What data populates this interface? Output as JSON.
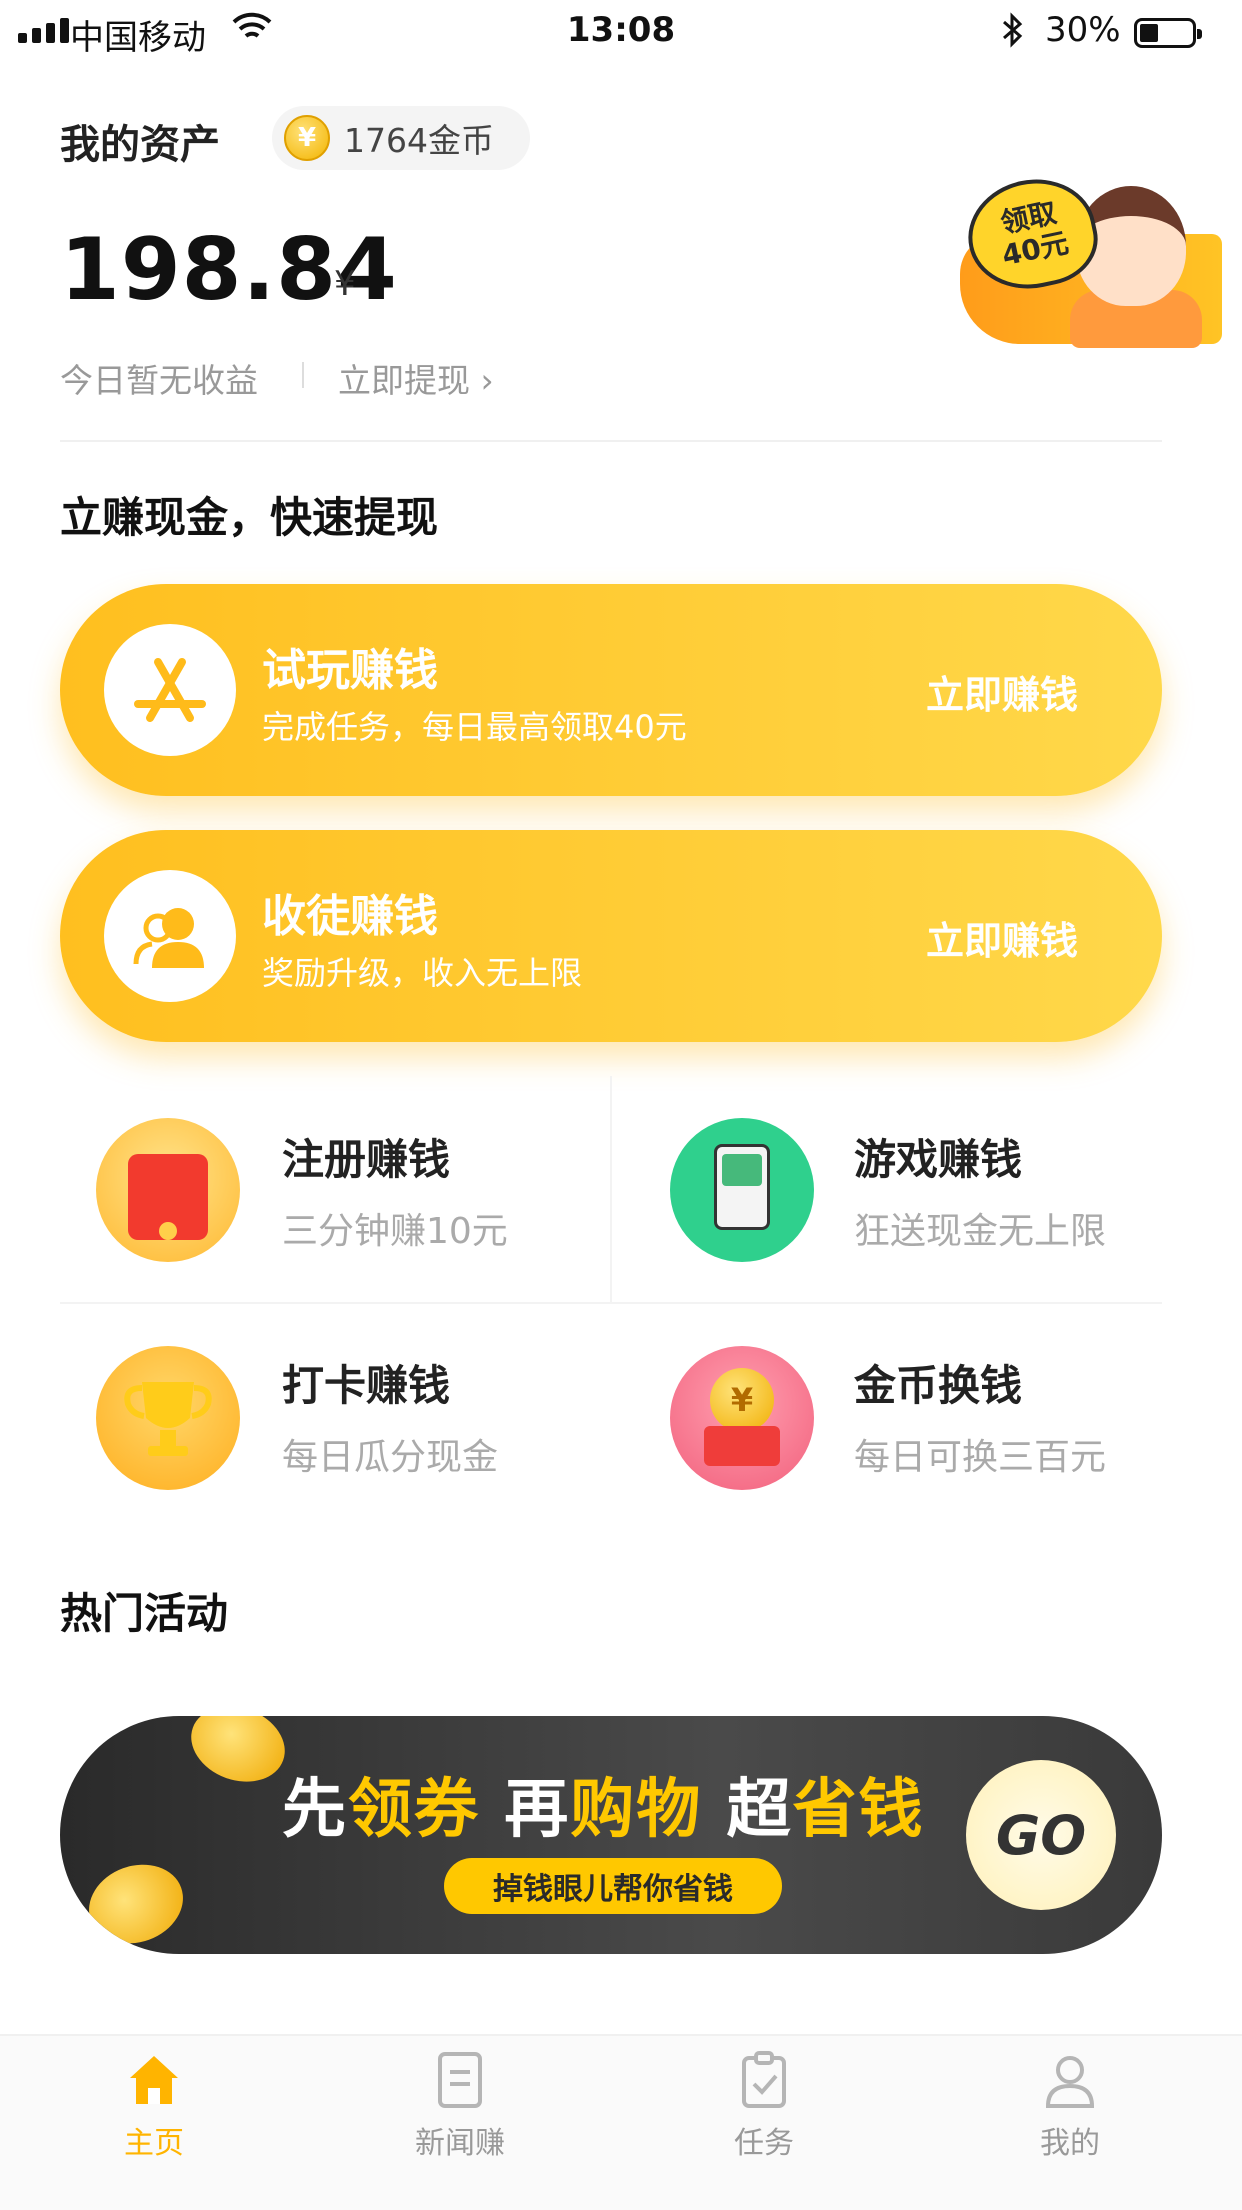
{
  "status_bar": {
    "carrier": "中国移动",
    "time": "13:08",
    "battery": "30%"
  },
  "assets": {
    "title": "我的资产",
    "coins": "1764金币",
    "coin_symbol": "¥",
    "balance": "198.84",
    "currency": "¥",
    "today": "今日暂无收益",
    "withdraw": "立即提现",
    "promo_line1": "领取",
    "promo_line2": "40元"
  },
  "section_title": "立赚现金，快速提现",
  "big_cards": [
    {
      "title": "试玩赚钱",
      "subtitle": "完成任务，每日最高领取40元",
      "button": "立即赚钱",
      "icon": "app-store-icon"
    },
    {
      "title": "收徒赚钱",
      "subtitle": "奖励升级，收入无上限",
      "button": "立即赚钱",
      "icon": "users-icon"
    }
  ],
  "grid": [
    {
      "title": "注册赚钱",
      "subtitle": "三分钟赚10元",
      "icon": "red-envelope-icon"
    },
    {
      "title": "游戏赚钱",
      "subtitle": "狂送现金无上限",
      "icon": "game-console-icon"
    },
    {
      "title": "打卡赚钱",
      "subtitle": "每日瓜分现金",
      "icon": "trophy-icon"
    },
    {
      "title": "金币换钱",
      "subtitle": "每日可换三百元",
      "icon": "gold-coin-icon"
    }
  ],
  "hot": {
    "title": "热门活动",
    "banner_w1": "先",
    "banner_y1": "领券",
    "banner_w2": " 再",
    "banner_y2": "购物",
    "banner_w3": " 超",
    "banner_y3": "省钱",
    "banner_sub": "掉钱眼儿帮你省钱",
    "banner_go": "GO"
  },
  "tabs": [
    {
      "label": "主页",
      "icon": "home-icon",
      "active": true
    },
    {
      "label": "新闻赚",
      "icon": "news-icon",
      "active": false
    },
    {
      "label": "任务",
      "icon": "task-icon",
      "active": false
    },
    {
      "label": "我的",
      "icon": "profile-icon",
      "active": false
    }
  ],
  "colors": {
    "accent": "#ffbf1f",
    "tab_active": "#ffb400"
  }
}
